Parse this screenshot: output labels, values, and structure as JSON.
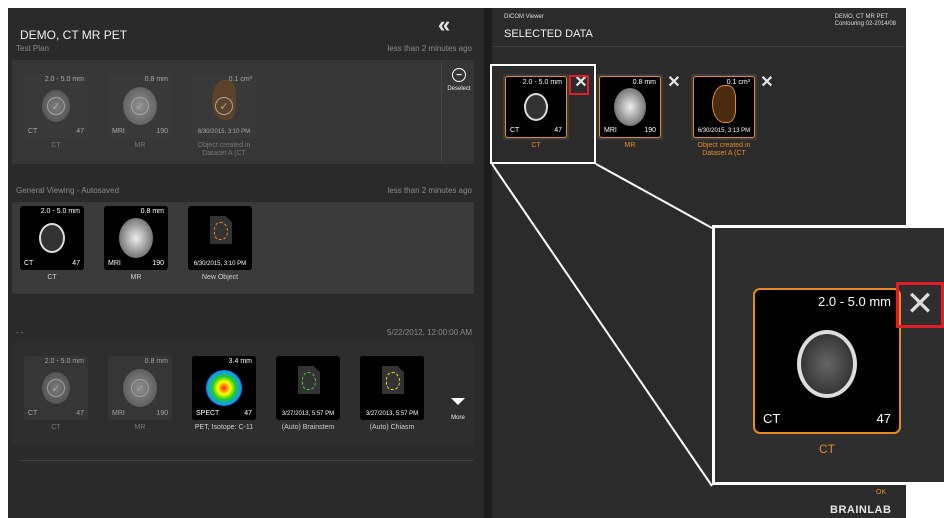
{
  "left": {
    "title": "DEMO, CT MR PET",
    "sections": [
      {
        "name": "Test Plan",
        "time": "less than 2 minutes ago"
      },
      {
        "name": "General Viewing - Autosaved",
        "time": "less than 2 minutes ago"
      },
      {
        "name": "- -",
        "time": "5/22/2012, 12:00:00 AM"
      }
    ],
    "test_plan": {
      "ct": {
        "top": "2.0 - 5.0 mm",
        "bl": "CT",
        "br": "47",
        "caption": "CT"
      },
      "mr": {
        "top": "0.8 mm",
        "bl": "MRI",
        "br": "190",
        "caption": "MR"
      },
      "obj": {
        "top": "0.1 cm³",
        "bottom": "6/30/2015, 3:10 PM",
        "caption": "Object created in Dataset A (CT"
      },
      "deselect_label": "Deselect"
    },
    "general": {
      "ct": {
        "top": "2.0 - 5.0 mm",
        "bl": "CT",
        "br": "47",
        "caption": "CT"
      },
      "mr": {
        "top": "0.8 mm",
        "bl": "MRI",
        "br": "190",
        "caption": "MR"
      },
      "obj": {
        "bottom": "6/30/2015, 3:10 PM",
        "caption": "New Object"
      }
    },
    "other": {
      "ct": {
        "top": "2.0 - 5.0 mm",
        "bl": "CT",
        "br": "47",
        "caption": "CT"
      },
      "mr": {
        "top": "0.8 mm",
        "bl": "MRI",
        "br": "190",
        "caption": "MR"
      },
      "pet": {
        "top": "3.4 mm",
        "bl": "SPECT",
        "br": "47",
        "caption": "PET, Isotope: C-11"
      },
      "brainstem": {
        "bottom": "3/27/2013, 5:57 PM",
        "caption": "(Auto) Brainstem"
      },
      "chiasm": {
        "bottom": "3/27/2013, 5:57 PM",
        "caption": "(Auto) Chiasm"
      },
      "more_label": "More"
    },
    "collapse_glyph": "«"
  },
  "right": {
    "app": "DICOM Viewer",
    "title": "SELECTED DATA",
    "patient_line1": "DEMO, CT MR PET",
    "patient_line2": "Contouring 02-2014/08",
    "selected": {
      "ct": {
        "top": "2.0 - 5.0 mm",
        "bl": "CT",
        "br": "47",
        "caption": "CT"
      },
      "mr": {
        "top": "0.8 mm",
        "bl": "MRI",
        "br": "190",
        "caption": "MR"
      },
      "obj": {
        "top": "0.1 cm³",
        "bottom": "6/30/2015, 3:13 PM",
        "caption": "Object created in Dataset A (CT"
      }
    },
    "remove_glyph": "✕",
    "zoom": {
      "top": "2.0 - 5.0 mm",
      "bl": "CT",
      "br": "47",
      "caption": "CT"
    },
    "ok_label": "OK",
    "brand": "BRAINLAB"
  },
  "colors": {
    "accent": "#e88a22",
    "highlight": "#e01e2a"
  },
  "icons": [
    "collapse-icon",
    "check-icon",
    "deselect-icon",
    "close-icon",
    "more-arrow-icon",
    "brainlab-logo"
  ]
}
